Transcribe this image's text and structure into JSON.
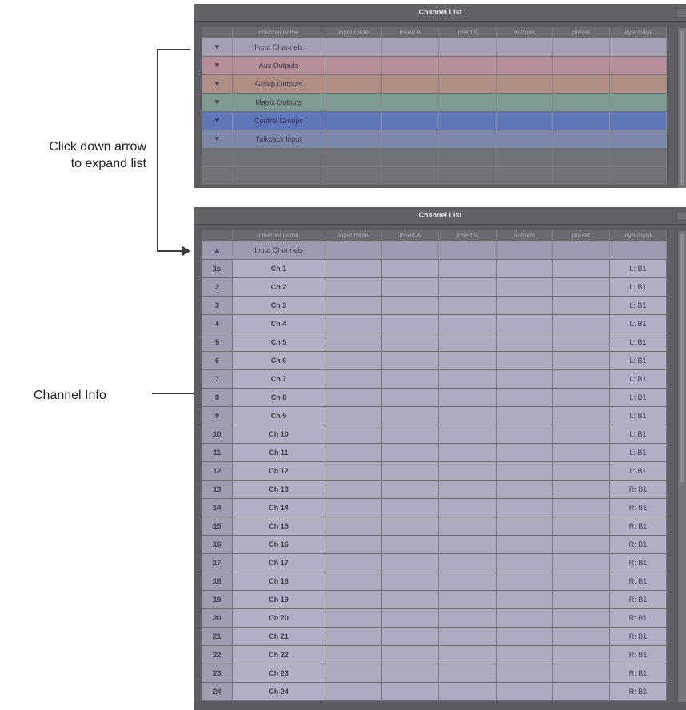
{
  "annotations": {
    "expand_line1": "Click down arrow",
    "expand_line2": "to expand list",
    "channel_info": "Channel Info"
  },
  "top_panel": {
    "title": "Channel List",
    "columns": [
      "channel name",
      "input route",
      "insert A",
      "insert B",
      "outputs",
      "preset",
      "layer/bank"
    ],
    "groups": [
      {
        "icon": "down-triangle-icon",
        "label": "Input Channels",
        "color": "#a3a0b4"
      },
      {
        "icon": "down-triangle-icon",
        "label": "Aux Outputs",
        "color": "#b58e9a"
      },
      {
        "icon": "down-triangle-icon",
        "label": "Group Outputs",
        "color": "#b08e86"
      },
      {
        "icon": "down-triangle-icon",
        "label": "Matrix Outputs",
        "color": "#7f9a91"
      },
      {
        "icon": "down-triangle-icon",
        "label": "Control Groups",
        "color": "#5f77b8"
      },
      {
        "icon": "down-triangle-icon",
        "label": "Talkback Input",
        "color": "#7c88aa"
      }
    ]
  },
  "bottom_panel": {
    "title": "Channel List",
    "columns": [
      "channel name",
      "input route",
      "insert A",
      "insert B",
      "outputs",
      "preset",
      "layer/bank"
    ],
    "expanded_group": {
      "icon": "up-triangle-icon",
      "label": "Input Channels"
    },
    "channels": [
      {
        "num": "1s",
        "name": "Ch 1",
        "layer": "L: B1"
      },
      {
        "num": "2",
        "name": "Ch 2",
        "layer": "L: B1"
      },
      {
        "num": "3",
        "name": "Ch 3",
        "layer": "L: B1"
      },
      {
        "num": "4",
        "name": "Ch 4",
        "layer": "L: B1"
      },
      {
        "num": "5",
        "name": "Ch 5",
        "layer": "L: B1"
      },
      {
        "num": "6",
        "name": "Ch 6",
        "layer": "L: B1"
      },
      {
        "num": "7",
        "name": "Ch 7",
        "layer": "L: B1"
      },
      {
        "num": "8",
        "name": "Ch 8",
        "layer": "L: B1"
      },
      {
        "num": "9",
        "name": "Ch 9",
        "layer": "L: B1"
      },
      {
        "num": "10",
        "name": "Ch 10",
        "layer": "L: B1"
      },
      {
        "num": "11",
        "name": "Ch 11",
        "layer": "L: B1"
      },
      {
        "num": "12",
        "name": "Ch 12",
        "layer": "L: B1"
      },
      {
        "num": "13",
        "name": "Ch 13",
        "layer": "R: B1"
      },
      {
        "num": "14",
        "name": "Ch 14",
        "layer": "R: B1"
      },
      {
        "num": "15",
        "name": "Ch 15",
        "layer": "R: B1"
      },
      {
        "num": "16",
        "name": "Ch 16",
        "layer": "R: B1"
      },
      {
        "num": "17",
        "name": "Ch 17",
        "layer": "R: B1"
      },
      {
        "num": "18",
        "name": "Ch 18",
        "layer": "R: B1"
      },
      {
        "num": "19",
        "name": "Ch 19",
        "layer": "R: B1"
      },
      {
        "num": "20",
        "name": "Ch 20",
        "layer": "R: B1"
      },
      {
        "num": "21",
        "name": "Ch 21",
        "layer": "R: B1"
      },
      {
        "num": "22",
        "name": "Ch 22",
        "layer": "R: B1"
      },
      {
        "num": "23",
        "name": "Ch 23",
        "layer": "R: B1"
      },
      {
        "num": "24",
        "name": "Ch 24",
        "layer": "R: B1"
      }
    ]
  },
  "colors": {
    "panel_bg": "#5f5f63",
    "channel_row": "#adaabf",
    "control_groups": "#5f77b8"
  }
}
